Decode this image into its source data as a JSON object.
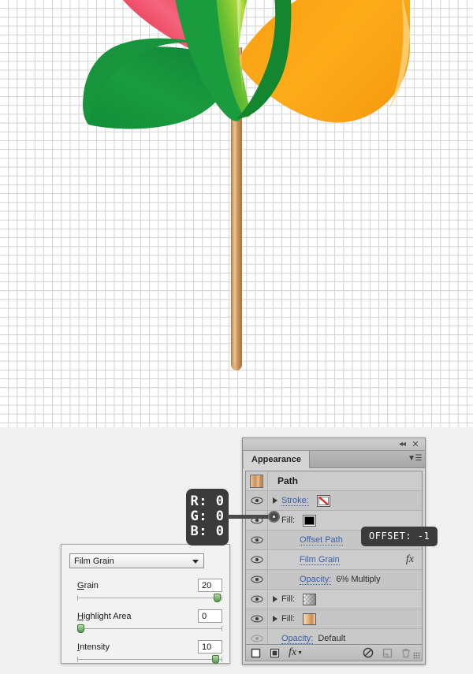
{
  "canvas": {
    "artwork_name": "pinwheel-illustration",
    "grid": "graph-paper",
    "blades": [
      {
        "name": "blade-green-left",
        "color": "#199a3c"
      },
      {
        "name": "blade-red-top",
        "color": "#ee2b3f"
      },
      {
        "name": "blade-green-center",
        "color": "#2fae3b"
      },
      {
        "name": "blade-orange-right",
        "color": "#f9a61a"
      }
    ],
    "stick": {
      "name": "pinwheel-stick",
      "color": "#c48c56"
    }
  },
  "panel": {
    "tab_label": "Appearance",
    "collapse_icon": "collapse-to-icons-icon",
    "close_icon": "close-icon",
    "menu_icon": "panel-menu-icon",
    "rows": [
      {
        "id": "path",
        "label": "Path",
        "type": "header",
        "thumbnail": "wood-gradient-thumbnail"
      },
      {
        "id": "stroke",
        "label": "Stroke:",
        "type": "link",
        "swatch": "none-swatch",
        "eye": "visibility-eye-icon",
        "triangle": "expand-triangle-icon"
      },
      {
        "id": "fill-top",
        "label": "Fill:",
        "type": "link",
        "swatch": "black-swatch",
        "eye": "visibility-eye-icon"
      },
      {
        "id": "offset-path",
        "label": "Offset Path",
        "type": "effect",
        "eye": "visibility-eye-icon"
      },
      {
        "id": "film-grain",
        "label": "Film Grain",
        "type": "effect",
        "fx": "fx",
        "eye": "visibility-eye-icon"
      },
      {
        "id": "opacity-1",
        "label": "Opacity:",
        "value": "6% Multiply",
        "type": "opacity",
        "eye": "visibility-eye-icon"
      },
      {
        "id": "fill-2",
        "label": "Fill:",
        "type": "link",
        "swatch": "gradient-checker-swatch",
        "eye": "visibility-eye-icon",
        "triangle": "expand-triangle-icon"
      },
      {
        "id": "fill-3",
        "label": "Fill:",
        "type": "link",
        "swatch": "wood-gradient-swatch",
        "eye": "visibility-eye-icon",
        "triangle": "expand-triangle-icon"
      },
      {
        "id": "opacity-default",
        "label": "Opacity:",
        "value": "Default",
        "type": "opacity",
        "eye": "visibility-eye-icon-disabled"
      }
    ],
    "footer": {
      "add_stroke": "add-new-stroke-icon",
      "add_fill": "add-new-fill-icon",
      "fx": "fx",
      "clear": "clear-appearance-icon",
      "duplicate": "duplicate-item-icon",
      "delete": "delete-item-icon",
      "grip": "resize-grip"
    }
  },
  "tooltips": {
    "rgb": {
      "r": "R: 0",
      "g": "G: 0",
      "b": "B: 0"
    },
    "offset": "OFFSET: -1"
  },
  "filmgrain": {
    "effect_name": "Film Grain",
    "fields": [
      {
        "label_prefix": "",
        "label_accel": "G",
        "label_suffix": "rain",
        "value": "20",
        "slider_pct": 96
      },
      {
        "label_prefix": "",
        "label_accel": "H",
        "label_suffix": "ighlight Area",
        "value": "0",
        "slider_pct": 2
      },
      {
        "label_prefix": "",
        "label_accel": "I",
        "label_suffix": "ntensity",
        "value": "10",
        "slider_pct": 95
      }
    ]
  },
  "colors": {
    "panel_bg": "#d4d4d4",
    "row_bg": "#cccccc",
    "link_blue": "#3a5fa8",
    "tooltip_bg": "#3b3b3b",
    "slider_green": "#4f9b45"
  }
}
